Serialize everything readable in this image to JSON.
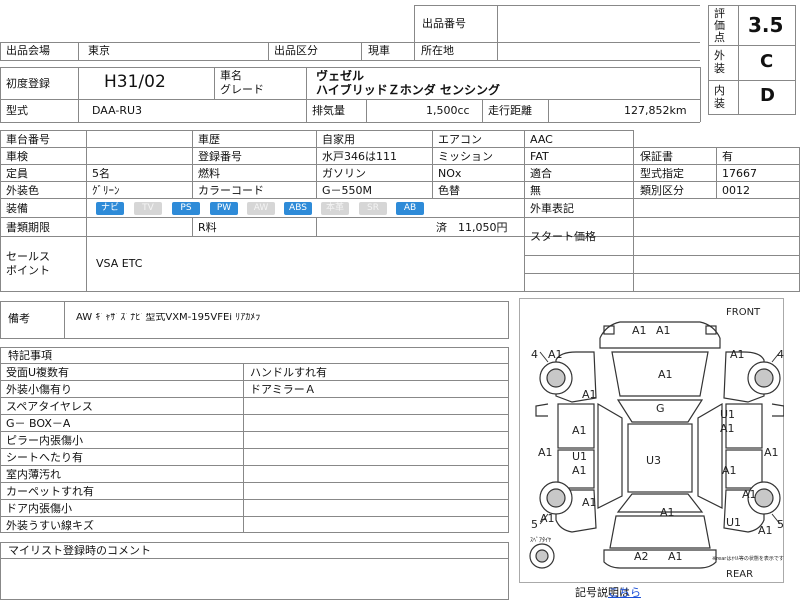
{
  "top": {
    "listing_no_label": "出品番号",
    "listing_no_value": "",
    "venue_label": "出品会場",
    "venue_value": "東京",
    "category_label": "出品区分",
    "category_value": "現車",
    "location_label": "所在地",
    "location_value": ""
  },
  "grades": {
    "score_label": "評価点",
    "score_value": "3.5",
    "exterior_label": "外装",
    "exterior_value": "C",
    "interior_label": "内装",
    "interior_value": "D"
  },
  "vehicle": {
    "first_reg_label": "初度登録",
    "first_reg_value": "H31/02",
    "name_label": "車名",
    "grade_label": "グレード",
    "name_value": "ヴェゼル",
    "grade_value": "ハイブリッドＺホンダ センシング",
    "model_label": "型式",
    "model_value": "DAA-RU3",
    "displacement_label": "排気量",
    "displacement_value": "1,500cc",
    "mileage_label": "走行距離",
    "mileage_value": "127,852km"
  },
  "details": {
    "chassis_label": "車台番号",
    "chassis_value": "",
    "history_label": "車歴",
    "history_value": "自家用",
    "ac_label": "エアコン",
    "ac_value": "AAC",
    "inspection_label": "車検",
    "inspection_value": "",
    "reg_no_label": "登録番号",
    "reg_no_value": "水戸346は111",
    "mission_label": "ミッション",
    "mission_value": "FAT",
    "warranty_label": "保証書",
    "warranty_value": "有",
    "capacity_label": "定員",
    "capacity_value": "5名",
    "fuel_label": "燃料",
    "fuel_value": "ガソリン",
    "nox_label": "NOx",
    "nox_value": "適合",
    "model_desig_label": "型式指定",
    "model_desig_value": "17667",
    "color_label": "外装色",
    "color_value": "ｸﾞﾘｰﾝ",
    "color_code_label": "カラーコード",
    "color_code_value": "G－550M",
    "color_change_label": "色替",
    "color_change_value": "無",
    "class_label": "類別区分",
    "class_value": "0012",
    "equipment_label": "装備",
    "equipment": [
      {
        "label": "ナビ",
        "on": true
      },
      {
        "label": "TV",
        "on": false
      },
      {
        "label": "PS",
        "on": true
      },
      {
        "label": "PW",
        "on": true
      },
      {
        "label": "AW",
        "on": false
      },
      {
        "label": "ABS",
        "on": true
      },
      {
        "label": "本革",
        "on": false
      },
      {
        "label": "SR",
        "on": false
      },
      {
        "label": "AB",
        "on": true
      }
    ],
    "foreign_label": "外車表記",
    "doc_deadline_label": "書類期限",
    "recycle_label": "R料",
    "recycle_value": "済　11,050円",
    "start_price_label": "スタート価格",
    "sales_point_label": "セールスポイント",
    "sales_point_label_1": "セールス",
    "sales_point_label_2": "ポイント",
    "sales_point_value": "VSA ETC"
  },
  "remarks": {
    "label": "備考",
    "value": "AW ｷﾞｬｻﾞｽﾞﾅﾋﾞ型式VXM-195VFEi ﾘｱｶﾒﾗ"
  },
  "special": {
    "title": "特記事項",
    "left": [
      "受面U複数有",
      "外装小傷有り",
      "スペアタイヤレス",
      "G－ BOX－A",
      "ピラー内張傷小",
      "シートへたり有",
      "室内薄汚れ",
      "カーペットすれ有",
      "ドア内張傷小",
      "外装うすい線キズ"
    ],
    "right": [
      "ハンドルすれ有",
      "ドアミラーＡ",
      "",
      "",
      "",
      "",
      "",
      "",
      "",
      ""
    ]
  },
  "comment": {
    "title": "マイリスト登録時のコメント"
  },
  "diagram": {
    "front": "FRONT",
    "rear": "REAR",
    "spare": "ｽﾍﾟｱﾀｲﾔ",
    "note": "※rearはｵｲﾙ等の状態を表示です",
    "legend_label": "記号説明は",
    "legend_link": "こちら",
    "marks": [
      "A1",
      "A1",
      "A1",
      "A1",
      "A1",
      "G",
      "A1",
      "U1",
      "A1",
      "A1",
      "A1",
      "A1",
      "U1",
      "A1",
      "U3",
      "A1",
      "A1",
      "A1",
      "A2",
      "A1",
      "A1",
      "U1",
      "A1",
      "A1"
    ],
    "wheel_nums": [
      "4",
      "4",
      "5",
      "5"
    ]
  },
  "colors": {
    "badge_on": "#2e8bd8",
    "badge_off": "#d6d6d6",
    "line": "#888888",
    "link": "#1a4fd8"
  }
}
